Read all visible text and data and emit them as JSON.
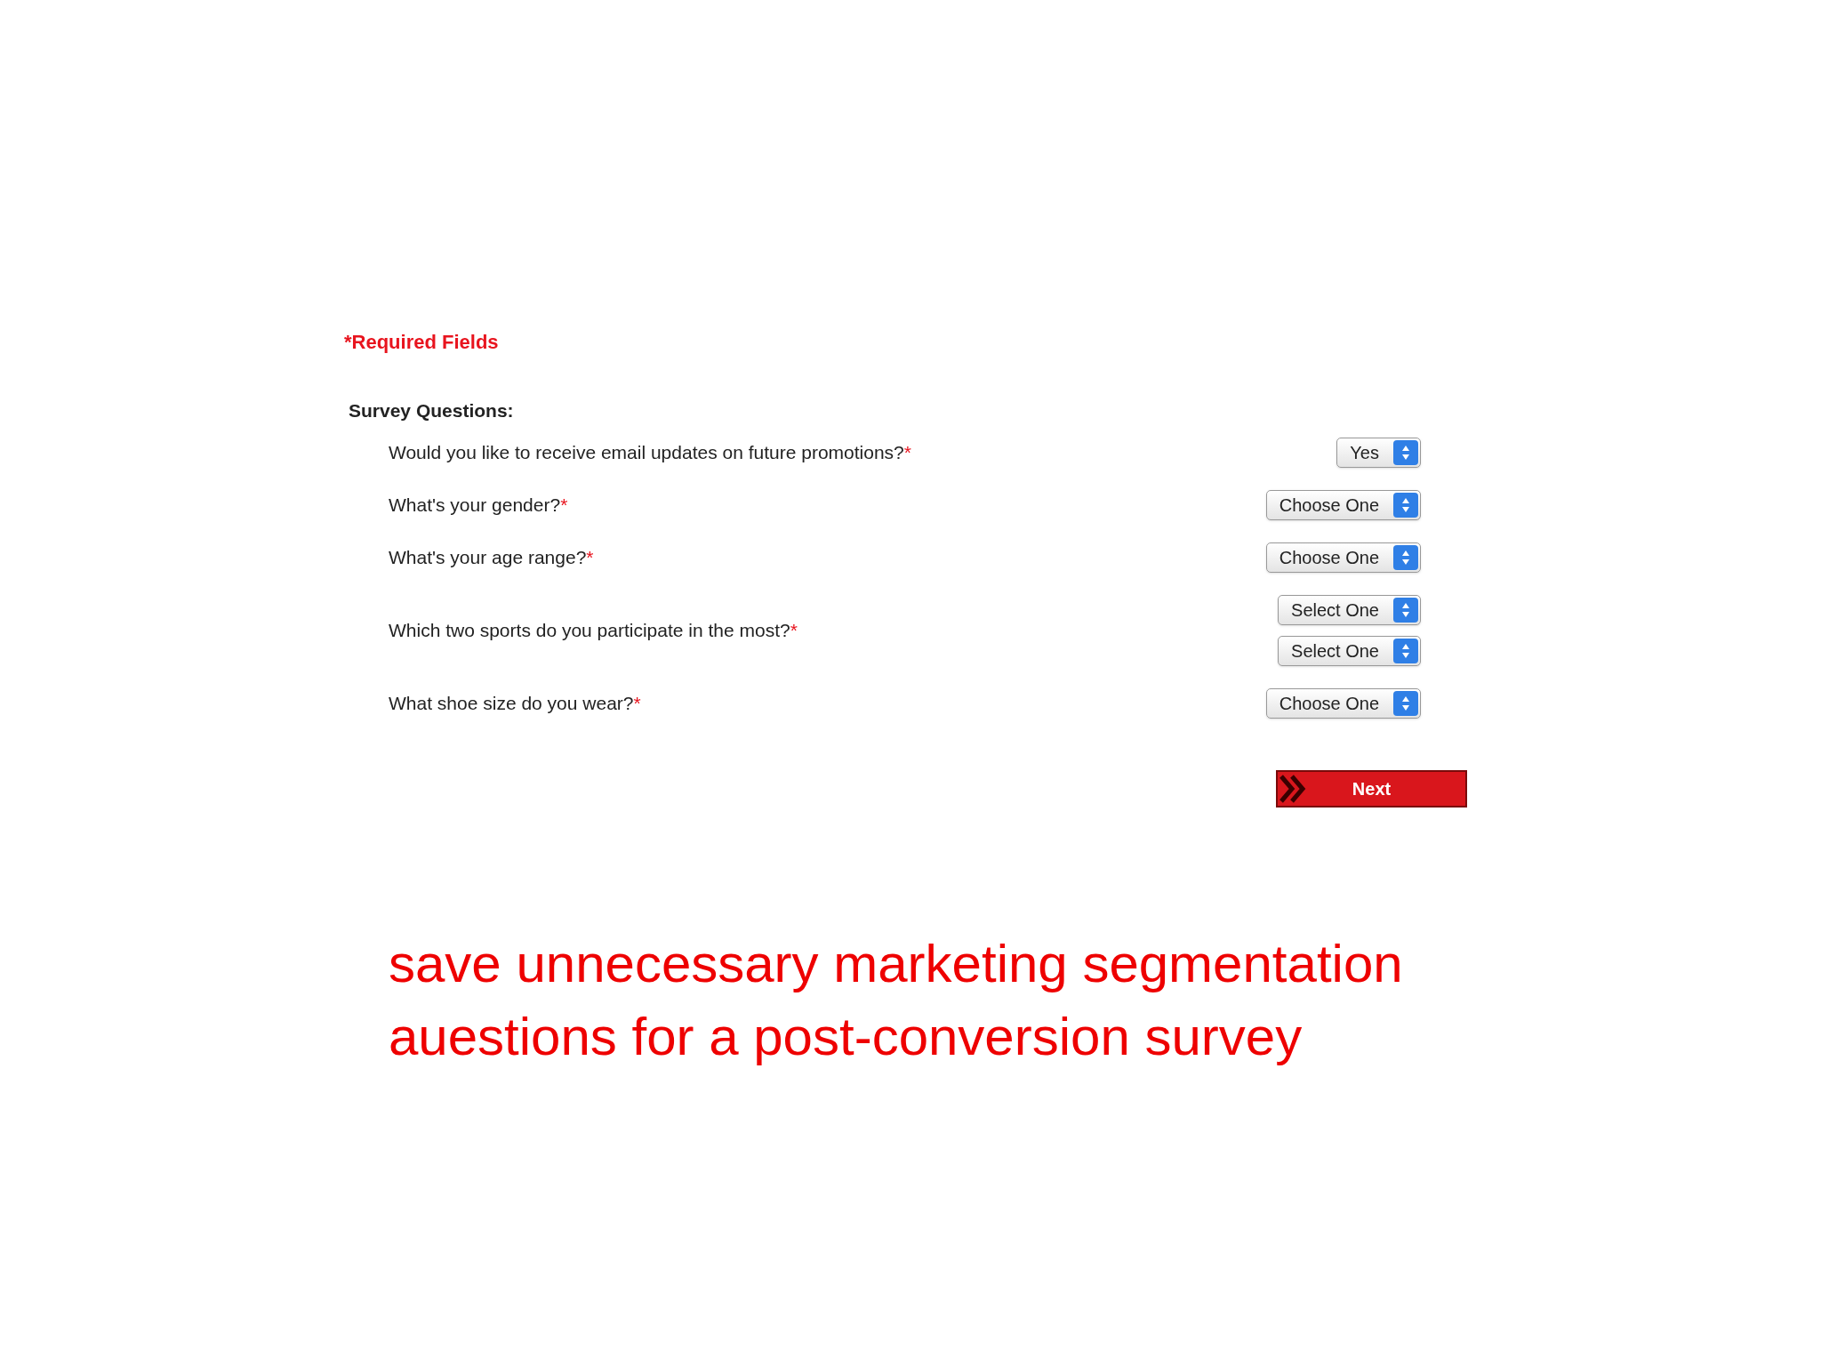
{
  "required_note": {
    "mark": "*",
    "text": "Required Fields"
  },
  "section_title": "Survey Questions:",
  "questions": [
    {
      "label": "Would you like to receive email updates on future promotions?",
      "required_mark": "*",
      "selects": [
        {
          "value": "Yes"
        }
      ]
    },
    {
      "label": "What's your gender?",
      "required_mark": "*",
      "selects": [
        {
          "value": "Choose One"
        }
      ]
    },
    {
      "label": "What's your age range?",
      "required_mark": "*",
      "selects": [
        {
          "value": "Choose One"
        }
      ]
    },
    {
      "label": "Which two sports do you participate in the most?",
      "required_mark": "*",
      "selects": [
        {
          "value": "Select One"
        },
        {
          "value": "Select One"
        }
      ]
    },
    {
      "label": "What shoe size do you wear?",
      "required_mark": "*",
      "selects": [
        {
          "value": "Choose One"
        }
      ]
    }
  ],
  "next_button": "Next",
  "caption": "save unnecessary marketing segmentation auestions for a post-conversion survey"
}
